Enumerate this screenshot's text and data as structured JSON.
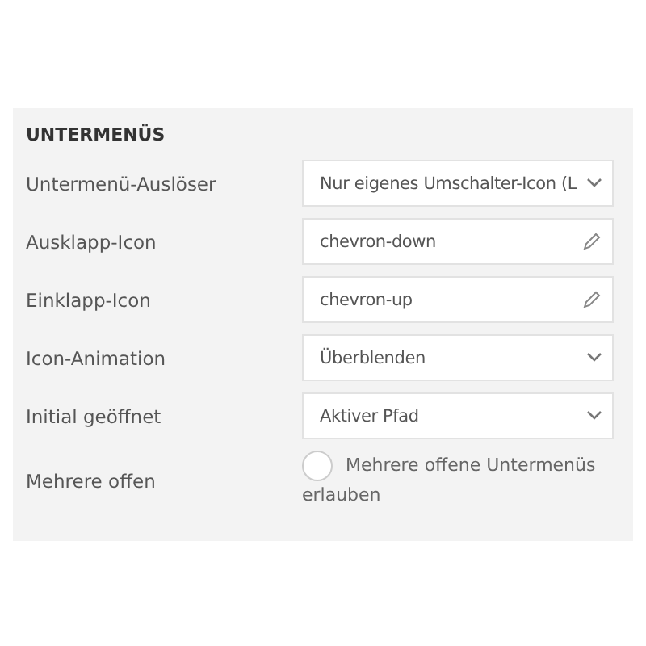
{
  "section": {
    "title": "UNTERMENÜS"
  },
  "rows": [
    {
      "label": "Untermenü-Auslöser",
      "kind": "select",
      "value": "Nur eigenes Umschalter-Icon (L"
    },
    {
      "label": "Ausklapp-Icon",
      "kind": "text",
      "value": "chevron-down"
    },
    {
      "label": "Einklapp-Icon",
      "kind": "text",
      "value": "chevron-up"
    },
    {
      "label": "Icon-Animation",
      "kind": "select",
      "value": "Überblenden"
    },
    {
      "label": "Initial geöffnet",
      "kind": "select",
      "value": "Aktiver Pfad"
    },
    {
      "label": "Mehrere offen",
      "kind": "checkbox",
      "value": "Mehrere offene Untermenüs erlauben",
      "checked": false
    }
  ]
}
